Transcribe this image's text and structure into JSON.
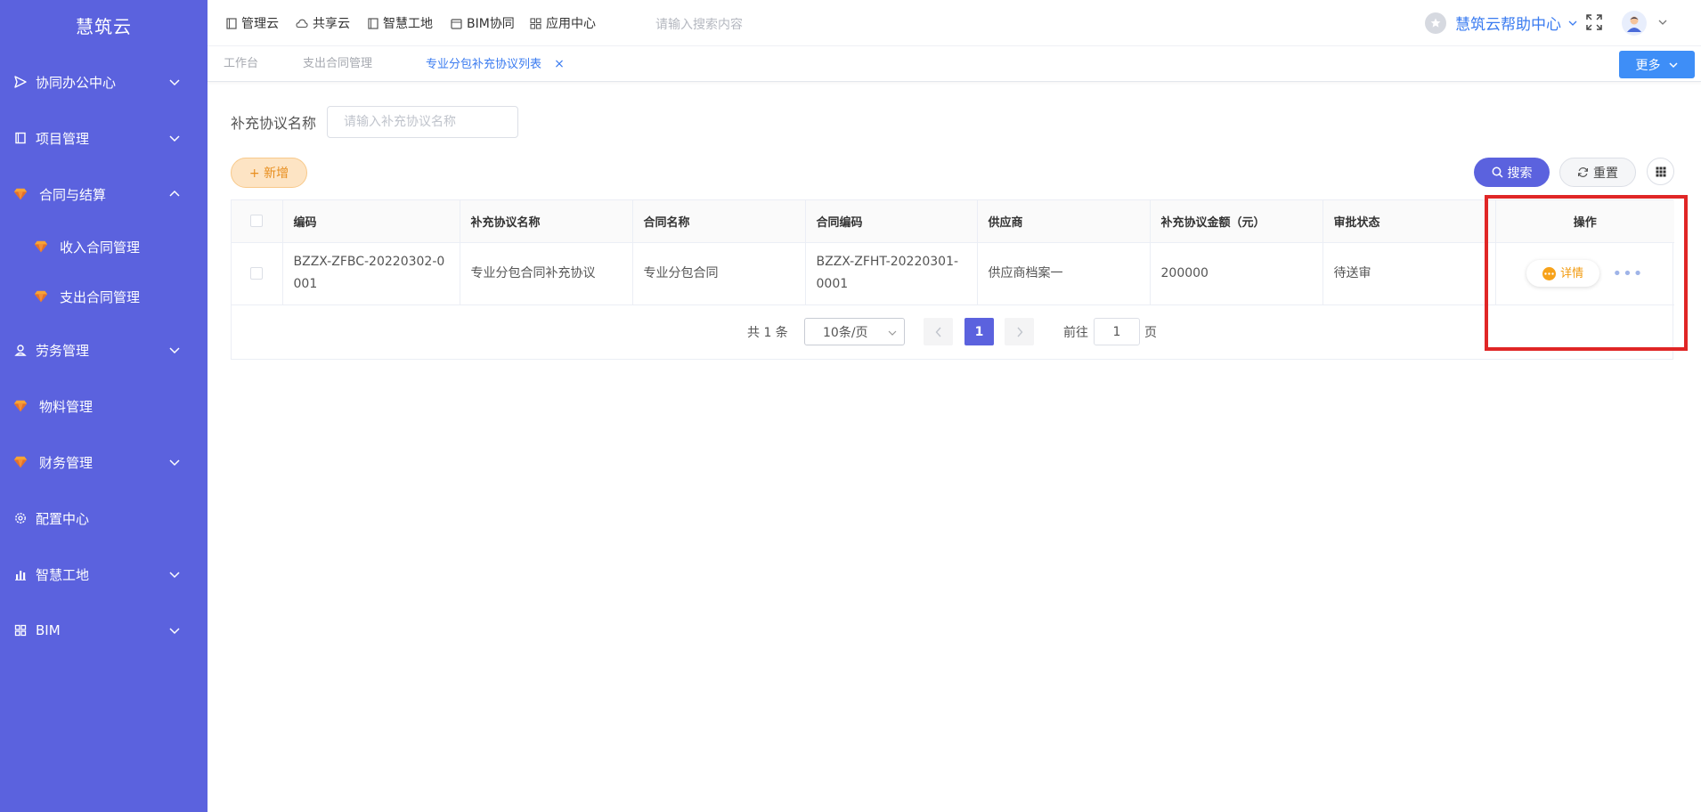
{
  "app": {
    "name": "慧筑云"
  },
  "sidebar": {
    "items": [
      {
        "label": "协同办公中心",
        "icon": "send-icon",
        "expandable": true,
        "expanded": false
      },
      {
        "label": "项目管理",
        "icon": "book-icon",
        "expandable": true,
        "expanded": false
      },
      {
        "label": "合同与结算",
        "icon": "gem-icon",
        "expandable": true,
        "expanded": true
      },
      {
        "label": "收入合同管理",
        "icon": "gem-icon",
        "sub": true
      },
      {
        "label": "支出合同管理",
        "icon": "gem-icon",
        "sub": true
      },
      {
        "label": "劳务管理",
        "icon": "user-icon",
        "expandable": true,
        "expanded": false
      },
      {
        "label": "物料管理",
        "icon": "gem-icon",
        "expandable": false
      },
      {
        "label": "财务管理",
        "icon": "gem-icon",
        "expandable": true,
        "expanded": false
      },
      {
        "label": "配置中心",
        "icon": "gear-icon",
        "expandable": false
      },
      {
        "label": "智慧工地",
        "icon": "bar-chart-icon",
        "expandable": true,
        "expanded": false
      },
      {
        "label": "BIM",
        "icon": "grid-icon",
        "expandable": true,
        "expanded": false
      }
    ]
  },
  "topnav": {
    "items": [
      {
        "label": "管理云",
        "icon": "document-icon"
      },
      {
        "label": "共享云",
        "icon": "cloud-icon"
      },
      {
        "label": "智慧工地",
        "icon": "document-icon"
      },
      {
        "label": "BIM协同",
        "icon": "box-icon"
      },
      {
        "label": "应用中心",
        "icon": "apps-icon"
      }
    ],
    "search_placeholder": "请输入搜索内容",
    "help_label": "慧筑云帮助中心"
  },
  "tabs": {
    "items": [
      {
        "label": "工作台",
        "active": false
      },
      {
        "label": "支出合同管理",
        "active": false
      },
      {
        "label": "专业分包补充协议列表",
        "active": true,
        "closable": true
      }
    ],
    "close_symbol": "×",
    "more_label": "更多"
  },
  "filter": {
    "label": "补充协议名称",
    "placeholder": "请输入补充协议名称",
    "value": ""
  },
  "toolbar": {
    "add_label": "+ 新增",
    "search_label": "搜索",
    "reset_label": "重置"
  },
  "table": {
    "columns": [
      "编码",
      "补充协议名称",
      "合同名称",
      "合同编码",
      "供应商",
      "补充协议金额（元）",
      "审批状态",
      "操作"
    ],
    "rows": [
      {
        "code": "BZZX-ZFBC-20220302-0001",
        "agreement_name": "专业分包合同补充协议",
        "contract_name": "专业分包合同",
        "contract_code": "BZZX-ZFHT-20220301-0001",
        "supplier": "供应商档案一",
        "amount": "200000",
        "status": "待送审",
        "action_detail": "详情",
        "action_more": "•••"
      }
    ]
  },
  "pagination": {
    "total_text": "共 1 条",
    "page_size": "10条/页",
    "current_page": "1",
    "goto_label": "前往",
    "goto_value": "1",
    "page_suffix": "页"
  },
  "colors": {
    "sidebar_bg": "#5b62de",
    "primary": "#5b62de",
    "link_blue": "#3a7bf0",
    "highlight_red": "#e02626",
    "add_orange": "#e88e1e"
  }
}
